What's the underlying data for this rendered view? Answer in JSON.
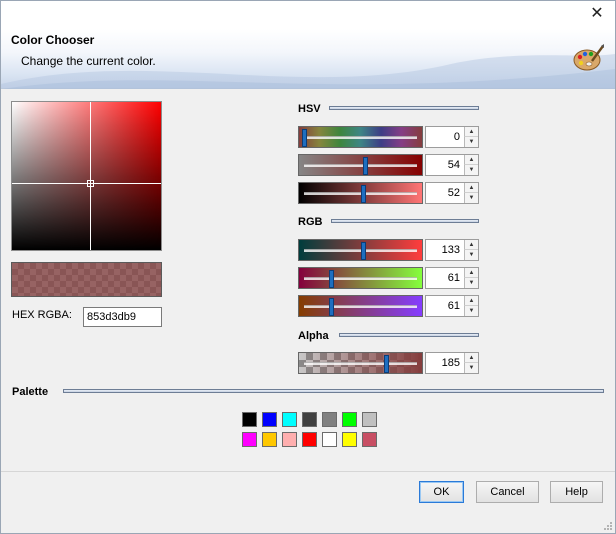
{
  "window": {
    "close_glyph": "✕"
  },
  "banner": {
    "title": "Color Chooser",
    "subtitle": "Change the current color.",
    "icon": "palette-icon"
  },
  "current": {
    "hex_label": "HEX RGBA:",
    "hex_value": "853d3db9",
    "rgba": "rgba(133,61,61,0.725)"
  },
  "hsv": {
    "label": "HSV",
    "sliders": [
      {
        "name": "hue",
        "value": "0",
        "fraction": 0.0
      },
      {
        "name": "saturation",
        "value": "54",
        "fraction": 0.54
      },
      {
        "name": "value",
        "value": "52",
        "fraction": 0.52
      }
    ]
  },
  "rgb": {
    "label": "RGB",
    "sliders": [
      {
        "name": "red",
        "value": "133",
        "fraction": 0.52
      },
      {
        "name": "green",
        "value": "61",
        "fraction": 0.24
      },
      {
        "name": "blue",
        "value": "61",
        "fraction": 0.24
      }
    ]
  },
  "alpha": {
    "label": "Alpha",
    "slider": {
      "name": "alpha",
      "value": "185",
      "fraction": 0.725
    }
  },
  "palette": {
    "label": "Palette",
    "row1": [
      "#000000",
      "#0000ff",
      "#00ffff",
      "#404040",
      "#808080",
      "#00ff00",
      "#c0c0c0"
    ],
    "row2": [
      "#ff00ff",
      "#ffc800",
      "#ffafaf",
      "#ff0000",
      "#ffffff",
      "#ffff00",
      "#c84f64"
    ]
  },
  "buttons": {
    "ok": "OK",
    "cancel": "Cancel",
    "help": "Help"
  },
  "colors": {
    "thumb": "#1e6ec0",
    "default_button_border": "#2a7ad8"
  }
}
